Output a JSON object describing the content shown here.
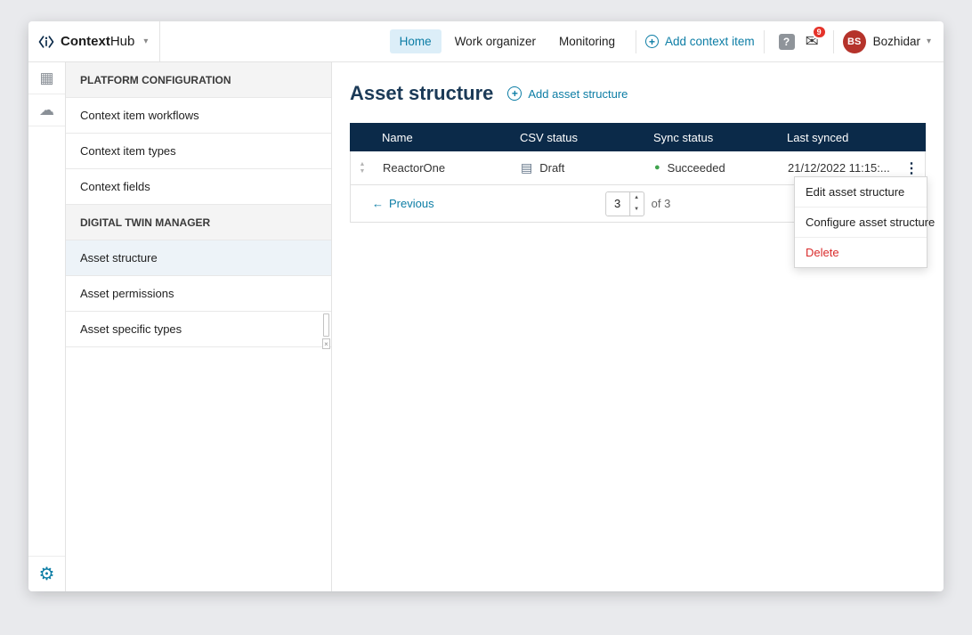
{
  "brand": {
    "bold": "Context",
    "light": "Hub"
  },
  "topnav": {
    "items": [
      {
        "label": "Home",
        "active": true
      },
      {
        "label": "Work organizer",
        "active": false
      },
      {
        "label": "Monitoring",
        "active": false
      }
    ],
    "add_button_label": "Add context item",
    "notifications_count": "9",
    "user": {
      "initials": "BS",
      "name": "Bozhidar"
    }
  },
  "sidebar": {
    "items": [
      {
        "label": "PLATFORM CONFIGURATION",
        "type": "section"
      },
      {
        "label": "Context item workflows",
        "type": "item"
      },
      {
        "label": "Context item types",
        "type": "item"
      },
      {
        "label": "Context fields",
        "type": "item"
      },
      {
        "label": "DIGITAL TWIN MANAGER",
        "type": "section"
      },
      {
        "label": "Asset structure",
        "type": "item",
        "selected": true
      },
      {
        "label": "Asset permissions",
        "type": "item"
      },
      {
        "label": "Asset specific types",
        "type": "item"
      }
    ]
  },
  "main": {
    "title": "Asset structure",
    "add_link_label": "Add asset structure"
  },
  "table": {
    "columns": [
      "",
      "Name",
      "CSV status",
      "Sync status",
      "Last synced",
      ""
    ],
    "rows": [
      {
        "name": "ReactorOne",
        "csv_status": "Draft",
        "sync_status": "Succeeded",
        "last_synced": "21/12/2022 11:15:..."
      }
    ],
    "pagination": {
      "previous": "Previous",
      "page": "3",
      "of": "of 3"
    }
  },
  "context_menu": {
    "items": [
      {
        "label": "Edit asset structure",
        "danger": false
      },
      {
        "label": "Configure asset structure",
        "danger": false
      },
      {
        "label": "Delete",
        "danger": true
      }
    ]
  },
  "icons": {
    "caret_down": "▾",
    "plus": "+",
    "help": "?",
    "mail": "✉",
    "kebab": "⋮",
    "sort_up": "▲",
    "sort_down": "▼",
    "dot": "●",
    "arrow_left": "←",
    "csv_draft": "▤",
    "dashboard": "▦",
    "cloud": "☁",
    "gear": "⚙",
    "close": "×"
  },
  "colors": {
    "accent": "#0c7da5",
    "header_navy": "#0b2a49",
    "success_green": "#3fa34d",
    "danger_red": "#d92b2b",
    "badge_red": "#e5332a",
    "avatar_red": "#b5332b",
    "active_nav_bg": "#dceef8",
    "selected_sidebar_bg": "#edf3f8"
  }
}
